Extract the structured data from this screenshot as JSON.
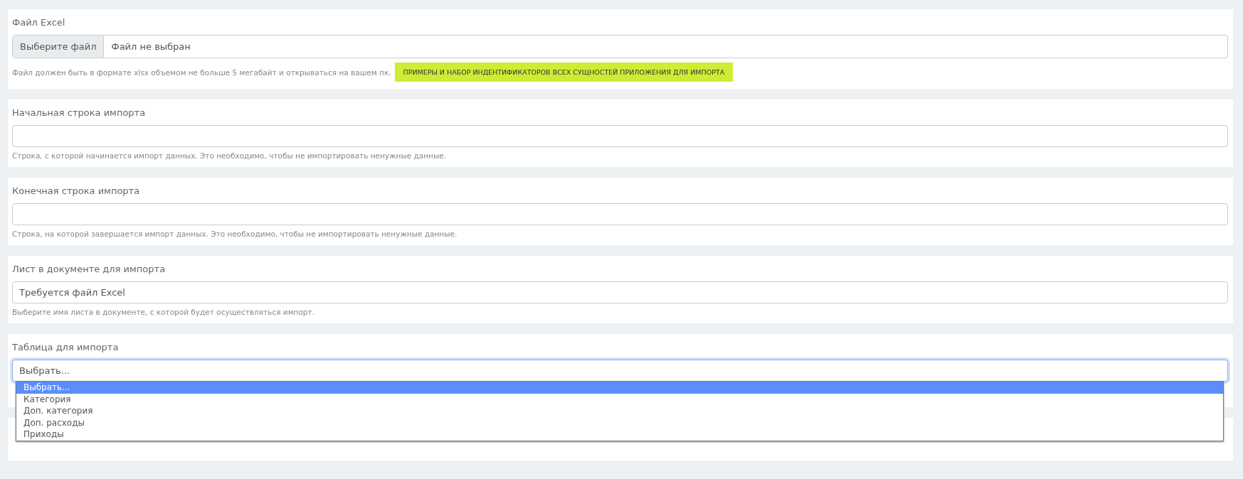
{
  "sections": [
    {
      "kind": "file",
      "label": "Файл Excel",
      "button": "Выберите файл",
      "value": "Файл не выбран",
      "help": "Файл должен быть в формате xlsx объемом не больше 5 мегабайт и открываться на вашем пк.",
      "link": "ПРИМЕРЫ И НАБОР ИНДЕНТИФИКАТОРОВ ВСЕХ СУЩНОСТЕЙ ПРИЛОЖЕНИЯ ДЛЯ ИМПОРТА"
    },
    {
      "kind": "text",
      "label": "Начальная строка импорта",
      "help": "Строка, с которой начинается импорт данных. Это необходимо, чтобы не импортировать ненужные данные."
    },
    {
      "kind": "text",
      "label": "Конечная строка импорта",
      "help": "Строка, на которой завершается импорт данных. Это необходимо, чтобы не импортировать ненужные данные."
    },
    {
      "kind": "text",
      "label": "Лист в документе для импорта",
      "value": "Требуется файл Excel",
      "help": "Выберите имя листа в документе, с которой будет осуществляться импорт."
    },
    {
      "kind": "select",
      "label": "Таблица для импорта",
      "value": "Выбрать...",
      "expanded": true,
      "options": [
        {
          "label": "Выбрать...",
          "selected": true
        },
        {
          "label": "Категория",
          "selected": false
        },
        {
          "label": "Доп. категория",
          "selected": false
        },
        {
          "label": "Доп. расходы",
          "selected": false
        },
        {
          "label": "Приходы",
          "selected": false
        }
      ]
    }
  ]
}
